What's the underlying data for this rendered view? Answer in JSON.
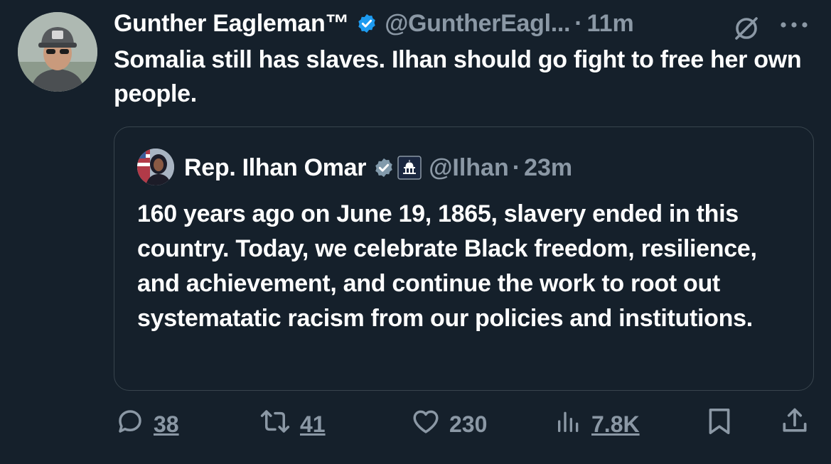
{
  "tweet": {
    "author_name": "Gunther Eagleman™",
    "handle": "@GuntherEagl...",
    "separator": "·",
    "time": "11m",
    "text": "Somalia still has slaves. Ilhan should go fight to free her own people."
  },
  "quoted": {
    "author_name": "Rep. Ilhan Omar",
    "handle": "@Ilhan",
    "separator": "·",
    "time": "23m",
    "text": "160 years ago on June 19, 1865, slavery ended in this country. Today, we celebrate Black freedom, resilience, and achievement, and continue the work to root out systematatic racism from our policies and institutions."
  },
  "actions": {
    "replies": "38",
    "retweets": "41",
    "likes": "230",
    "views": "7.8K"
  },
  "icons": {
    "verified": "verified-badge-icon",
    "grok": "grok-icon",
    "more": "more-icon",
    "reply": "reply-icon",
    "retweet": "retweet-icon",
    "like": "like-icon",
    "views": "views-icon",
    "bookmark": "bookmark-icon",
    "share": "share-icon"
  },
  "colors": {
    "background": "#15202b",
    "text": "#ffffff",
    "muted": "#8b98a5",
    "blue_badge": "#1d9bf0",
    "grey_badge": "#829aab",
    "border": "#38444d"
  }
}
